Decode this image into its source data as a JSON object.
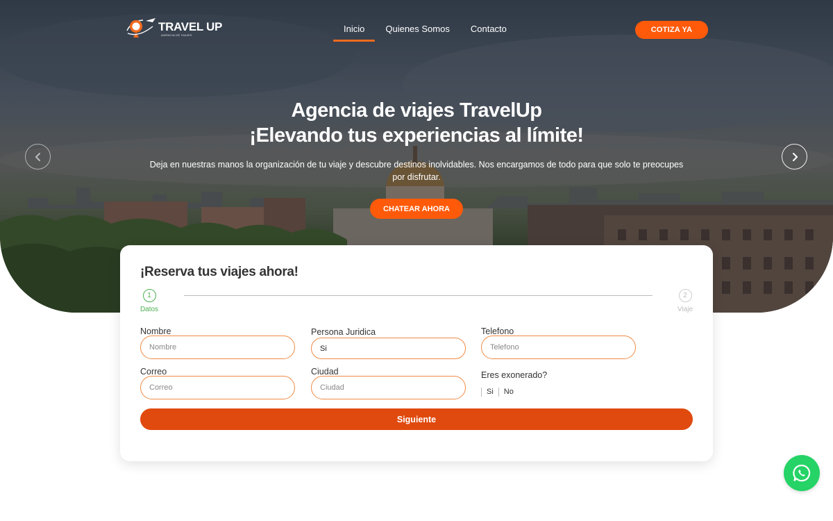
{
  "brand": {
    "name": "TRAVEL UP",
    "tagline": "AGENCIA DE VIAJES",
    "accent": "#ff5a0a",
    "success": "#4caf50"
  },
  "nav": {
    "items": [
      {
        "label": "Inicio",
        "active": true
      },
      {
        "label": "Quienes Somos",
        "active": false
      },
      {
        "label": "Contacto",
        "active": false
      }
    ],
    "cta_label": "COTIZA YA"
  },
  "hero": {
    "title_line1": "Agencia de viajes TravelUp",
    "title_line2": "¡Elevando tus experiencias al límite!",
    "description": "Deja en nuestras manos la organización de tu viaje y descubre destinos inolvidables. Nos encargamos de todo para que solo te preocupes por disfrutar.",
    "cta_label": "CHATEAR AHORA",
    "prev_icon": "chevron-left-icon",
    "next_icon": "chevron-right-icon"
  },
  "form": {
    "title": "¡Reserva tus viajes ahora!",
    "steps": [
      {
        "number": "1",
        "label": "Datos",
        "active": true
      },
      {
        "number": "2",
        "label": "Viaje",
        "active": false
      }
    ],
    "fields": {
      "nombre": {
        "label": "Nombre",
        "placeholder": "Nombre",
        "value": ""
      },
      "persona_juridica": {
        "label": "Persona Juridica",
        "value": "Si"
      },
      "telefono": {
        "label": "Telefono",
        "placeholder": "Telefono",
        "value": ""
      },
      "correo": {
        "label": "Correo",
        "placeholder": "Correo",
        "value": ""
      },
      "ciudad": {
        "label": "Ciudad",
        "placeholder": "Ciudad",
        "value": ""
      }
    },
    "exonerado": {
      "label": "Eres exonerado?",
      "options": [
        "Si",
        "No"
      ]
    },
    "next_label": "Siguiente"
  },
  "whatsapp": {
    "icon": "whatsapp-icon",
    "color": "#25d366"
  }
}
